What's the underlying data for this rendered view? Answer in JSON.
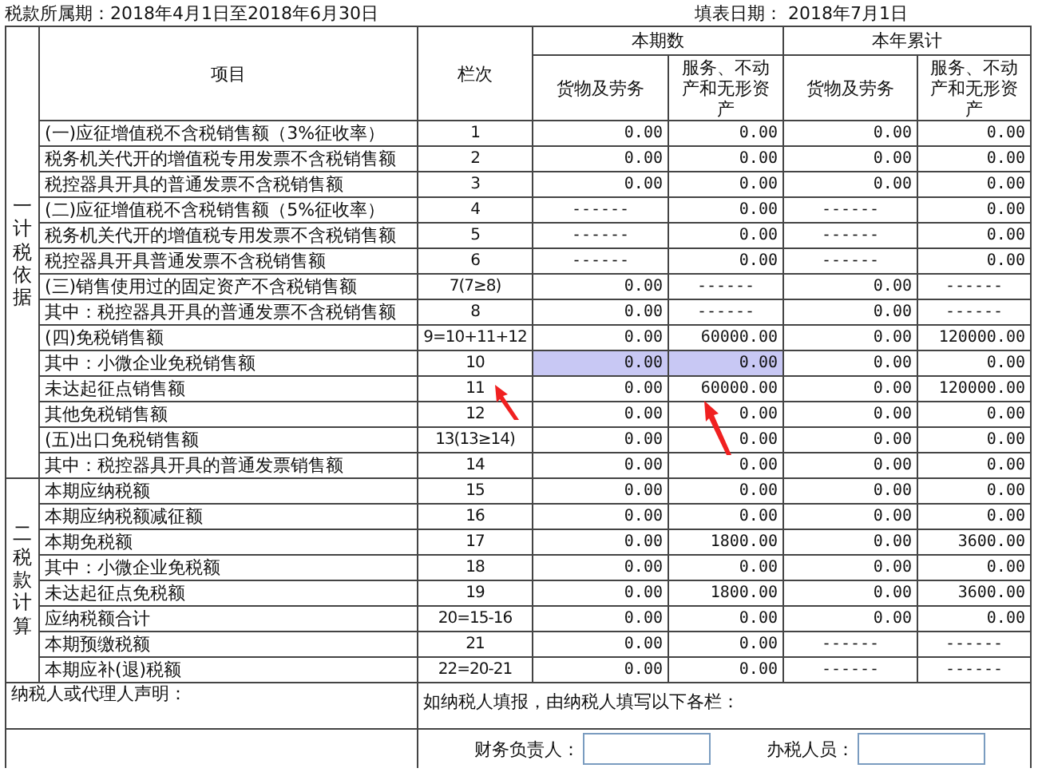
{
  "header": {
    "period": "税款所属期：2018年4月1日至2018年6月30日",
    "fill_date": "填表日期： 2018年7月1日"
  },
  "table": {
    "columns": {
      "item": "项目",
      "line": "栏次",
      "group_current": "本期数",
      "group_year": "本年累计",
      "sub": [
        "货物及劳务",
        "服务、不动产和无形资产",
        "货物及劳务",
        "服务、不动产和无形资产"
      ]
    },
    "sections": [
      {
        "label": "一计税依据",
        "rows": [
          {
            "item": "(一)应征增值税不含税销售额（3%征收率）",
            "line": "1",
            "values": [
              "0.00",
              "0.00",
              "0.00",
              "0.00"
            ],
            "highlighted": false
          },
          {
            "item": "税务机关代开的增值税专用发票不含税销售额",
            "line": "2",
            "values": [
              "0.00",
              "0.00",
              "0.00",
              "0.00"
            ],
            "highlighted": false
          },
          {
            "item": "税控器具开具的普通发票不含税销售额",
            "line": "3",
            "values": [
              "0.00",
              "0.00",
              "0.00",
              "0.00"
            ],
            "highlighted": false
          },
          {
            "item": "(二)应征增值税不含税销售额（5%征收率）",
            "line": "4",
            "values": [
              "------",
              "0.00",
              "------",
              "0.00"
            ],
            "highlighted": false
          },
          {
            "item": "税务机关代开的增值税专用发票不含税销售额",
            "line": "5",
            "values": [
              "------",
              "0.00",
              "------",
              "0.00"
            ],
            "highlighted": false
          },
          {
            "item": "税控器具开具普通发票不含税销售额",
            "line": "6",
            "values": [
              "------",
              "0.00",
              "------",
              "0.00"
            ],
            "highlighted": false
          },
          {
            "item": "(三)销售使用过的固定资产不含税销售额",
            "line": "7(7≥8)",
            "values": [
              "0.00",
              "------",
              "0.00",
              "------"
            ],
            "highlighted": false
          },
          {
            "item": "其中：税控器具开具的普通发票不含税销售额",
            "line": "8",
            "values": [
              "0.00",
              "------",
              "0.00",
              "------"
            ],
            "highlighted": false
          },
          {
            "item": "(四)免税销售额",
            "line": "9=10+11+12",
            "values": [
              "0.00",
              "60000.00",
              "0.00",
              "120000.00"
            ],
            "highlighted": false
          },
          {
            "item": "其中：小微企业免税销售额",
            "line": "10",
            "values": [
              "0.00",
              "0.00",
              "0.00",
              "0.00"
            ],
            "highlighted": true
          },
          {
            "item": "未达起征点销售额",
            "line": "11",
            "values": [
              "0.00",
              "60000.00",
              "0.00",
              "120000.00"
            ],
            "highlighted": false
          },
          {
            "item": "其他免税销售额",
            "line": "12",
            "values": [
              "0.00",
              "0.00",
              "0.00",
              "0.00"
            ],
            "highlighted": false
          },
          {
            "item": "(五)出口免税销售额",
            "line": "13(13≥14)",
            "values": [
              "0.00",
              "0.00",
              "0.00",
              "0.00"
            ],
            "highlighted": false
          },
          {
            "item": "其中：税控器具开具的普通发票销售额",
            "line": "14",
            "values": [
              "0.00",
              "0.00",
              "0.00",
              "0.00"
            ],
            "highlighted": false
          }
        ]
      },
      {
        "label": "二税款计算",
        "rows": [
          {
            "item": "本期应纳税额",
            "line": "15",
            "values": [
              "0.00",
              "0.00",
              "0.00",
              "0.00"
            ],
            "highlighted": false
          },
          {
            "item": "本期应纳税额减征额",
            "line": "16",
            "values": [
              "0.00",
              "0.00",
              "0.00",
              "0.00"
            ],
            "highlighted": false
          },
          {
            "item": "本期免税额",
            "line": "17",
            "values": [
              "0.00",
              "1800.00",
              "0.00",
              "3600.00"
            ],
            "highlighted": false
          },
          {
            "item": "其中：小微企业免税额",
            "line": "18",
            "values": [
              "0.00",
              "0.00",
              "0.00",
              "0.00"
            ],
            "highlighted": false
          },
          {
            "item": "未达起征点免税额",
            "line": "19",
            "values": [
              "0.00",
              "1800.00",
              "0.00",
              "3600.00"
            ],
            "highlighted": false
          },
          {
            "item": "应纳税额合计",
            "line": "20=15-16",
            "values": [
              "0.00",
              "0.00",
              "0.00",
              "0.00"
            ],
            "highlighted": false
          },
          {
            "item": "本期预缴税额",
            "line": "21",
            "values": [
              "0.00",
              "0.00",
              "------",
              "------"
            ],
            "highlighted": false
          },
          {
            "item": "本期应补(退)税额",
            "line": "22=20-21",
            "values": [
              "0.00",
              "0.00",
              "------",
              "------"
            ],
            "highlighted": false
          }
        ]
      }
    ]
  },
  "declaration": {
    "label": "纳税人或代理人声明：",
    "note": "如纳税人填报，由纳税人填写以下各栏：",
    "fields": [
      {
        "label": "财务负责人："
      },
      {
        "label": "办税人员："
      }
    ]
  }
}
